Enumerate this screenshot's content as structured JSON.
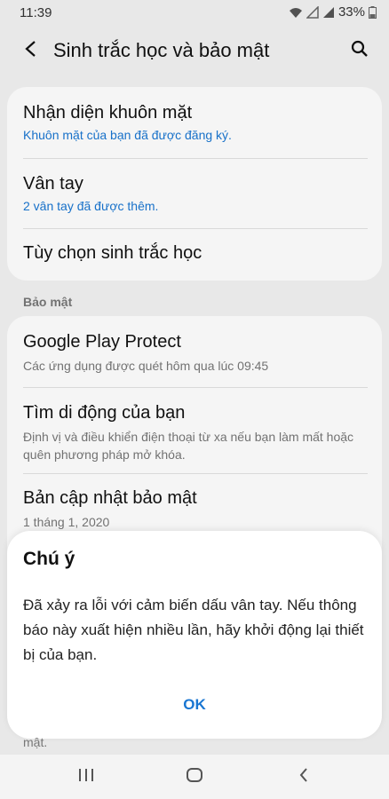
{
  "status_bar": {
    "time": "11:39",
    "battery": "33%",
    "icons": [
      "wifi-icon",
      "signal-icon",
      "signal-icon",
      "battery-icon"
    ]
  },
  "app_bar": {
    "title": "Sinh trắc học và bảo mật",
    "back_icon": "back-arrow-icon",
    "search_icon": "search-icon"
  },
  "biometrics": {
    "items": [
      {
        "title": "Nhận diện khuôn mặt",
        "subtitle": "Khuôn mặt của bạn đã được đăng ký."
      },
      {
        "title": "Vân tay",
        "subtitle": "2 vân tay đã được thêm."
      },
      {
        "title": "Tùy chọn sinh trắc học"
      }
    ]
  },
  "security": {
    "label": "Bảo mật",
    "items": [
      {
        "title": "Google Play Protect",
        "subtitle": "Các ứng dụng được quét hôm qua lúc 09:45"
      },
      {
        "title": "Tìm di động của bạn",
        "subtitle": "Định vị và điều khiển điện thoại từ xa nếu bạn làm mất hoặc quên phương pháp mở khóa."
      },
      {
        "title": "Bản cập nhật bảo mật",
        "subtitle": "1 tháng 1, 2020"
      }
    ],
    "peek_text": "mật."
  },
  "dialog": {
    "title": "Chú ý",
    "message": "Đã xảy ra lỗi với cảm biến dấu vân tay. Nếu thông báo này xuất hiện nhiều lần, hãy khởi động lại thiết bị của bạn.",
    "ok_label": "OK"
  },
  "nav_bar": {
    "icons": [
      "recents-icon",
      "home-icon",
      "back-icon"
    ]
  },
  "colors": {
    "accent": "#1976d2",
    "background": "#f2f2f2",
    "card": "#ffffff"
  }
}
